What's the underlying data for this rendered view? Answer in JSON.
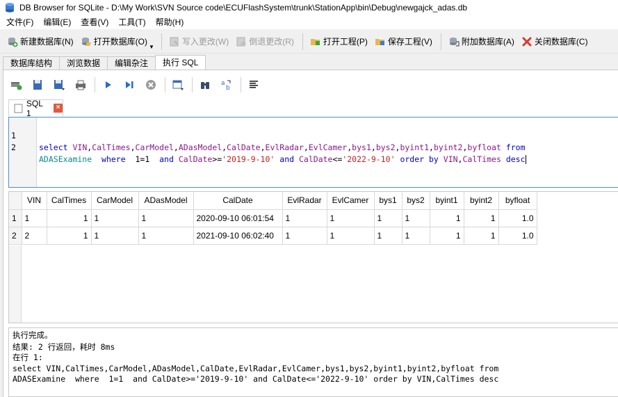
{
  "window": {
    "title": "DB Browser for SQLite - D:\\My Work\\SVN Source code\\ECUFlashSystem\\trunk\\StationApp\\bin\\Debug\\newgajck_adas.db"
  },
  "menu": [
    "文件(F)",
    "编辑(E)",
    "查看(V)",
    "工具(T)",
    "帮助(H)"
  ],
  "toolbar": {
    "new_db": "新建数据库(N)",
    "open_db": "打开数据库(O)",
    "write_changes": "写入更改(W)",
    "revert_changes": "倒退更改(R)",
    "open_project": "打开工程(P)",
    "save_project": "保存工程(V)",
    "attach_db": "附加数据库(A)",
    "close_db": "关闭数据库(C)"
  },
  "tabs": [
    "数据库结构",
    "浏览数据",
    "编辑杂注",
    "执行 SQL"
  ],
  "sql_tab": {
    "label": "SQL 1"
  },
  "editor": {
    "line_numbers": [
      "1",
      "2"
    ]
  },
  "grid": {
    "columns": [
      "VIN",
      "CalTimes",
      "CarModel",
      "ADasModel",
      "CalDate",
      "EvlRadar",
      "EvlCamer",
      "bys1",
      "bys2",
      "byint1",
      "byint2",
      "byfloat"
    ],
    "rows": [
      {
        "num": "1",
        "cells": [
          "1",
          "1",
          "1",
          "1",
          "2020-09-10 06:01:54",
          "1",
          "1",
          "1",
          "1",
          "1",
          "1",
          "1.0"
        ]
      },
      {
        "num": "2",
        "cells": [
          "2",
          "1",
          "1",
          "1",
          "2021-09-10 06:02:40",
          "1",
          "1",
          "1",
          "1",
          "1",
          "1",
          "1.0"
        ]
      }
    ]
  },
  "messages": [
    "执行完成。",
    "结果: 2 行返回，耗时 8ms",
    "在行 1:",
    "select VIN,CalTimes,CarModel,ADasModel,CalDate,EvlRadar,EvlCamer,bys1,bys2,byint1,byint2,byfloat from",
    "ADASExamine  where  1=1  and CalDate>='2019-9-10' and CalDate<='2022-9-10' order by VIN,CalTimes desc"
  ]
}
